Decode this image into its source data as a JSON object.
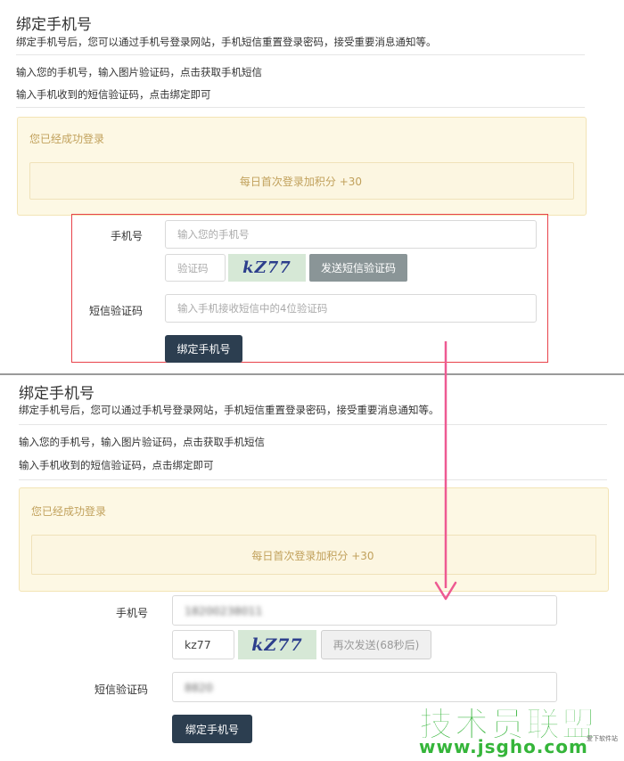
{
  "before": {
    "title": "绑定手机号",
    "subtitle": "绑定手机号后，您可以通过手机号登录网站，手机短信重置登录密码，接受重要消息通知等。",
    "steps": [
      "输入您的手机号，输入图片验证码，点击获取手机短信",
      "输入手机收到的短信验证码，点击绑定即可"
    ],
    "notice": {
      "title": "您已经成功登录",
      "message": "每日首次登录加积分 +30"
    },
    "form": {
      "phone_label": "手机号",
      "phone_placeholder": "输入您的手机号",
      "captcha_placeholder": "验证码",
      "captcha_text": "kZ77",
      "send_sms_button": "发送短信验证码",
      "sms_label": "短信验证码",
      "sms_placeholder": "输入手机接收短信中的4位验证码",
      "bind_button": "绑定手机号"
    }
  },
  "after": {
    "title": "绑定手机号",
    "subtitle": "绑定手机号后，您可以通过手机号登录网站，手机短信重置登录密码，接受重要消息通知等。",
    "steps": [
      "输入您的手机号，输入图片验证码，点击获取手机短信",
      "输入手机收到的短信验证码，点击绑定即可"
    ],
    "notice": {
      "title": "您已经成功登录",
      "message": "每日首次登录加积分 +30"
    },
    "form": {
      "phone_label": "手机号",
      "phone_value": "18200238011",
      "captcha_value": "kz77",
      "captcha_text": "kZ77",
      "resend_button": "再次发送(68秒后)",
      "sms_label": "短信验证码",
      "sms_value": "8820",
      "bind_button": "绑定手机号"
    }
  },
  "watermark": {
    "brand": "技术员联盟",
    "url": "www.jsgho.com",
    "tag": "爱下软件站"
  },
  "colors": {
    "highlight_box": "#e8424a",
    "arrow": "#ee5a92",
    "dark_button": "#2c3e50",
    "notice_bg": "#fdf8e4",
    "watermark_green": "#35b53a"
  }
}
